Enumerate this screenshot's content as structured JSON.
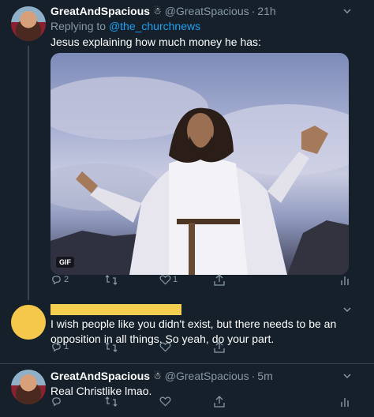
{
  "tweets": [
    {
      "name": "GreatAndSpacious",
      "badge": "☃",
      "handle": "@GreatSpacious",
      "time": "21h",
      "reply_prefix": "Replying to ",
      "reply_to": "@the_churchnews",
      "text": "Jesus explaining how much money he has:",
      "media_badge": "GIF",
      "replies": "2",
      "likes": "1"
    },
    {
      "text": "I wish people like you didn't exist, but there needs to be an opposition in all things. So yeah, do your part.",
      "replies": "1"
    },
    {
      "name": "GreatAndSpacious",
      "badge": "☃",
      "handle": "@GreatSpacious",
      "time": "5m",
      "text": "Real Christlike lmao."
    }
  ],
  "separator": "·",
  "colors": {
    "background": "#15202b",
    "text": "#ffffff",
    "secondary": "#8899a6",
    "link": "#1da1f2",
    "redaction": "#f5cf52"
  },
  "icons": [
    "reply-icon",
    "retweet-icon",
    "like-icon",
    "share-icon",
    "analytics-icon",
    "chevron-down-icon"
  ]
}
